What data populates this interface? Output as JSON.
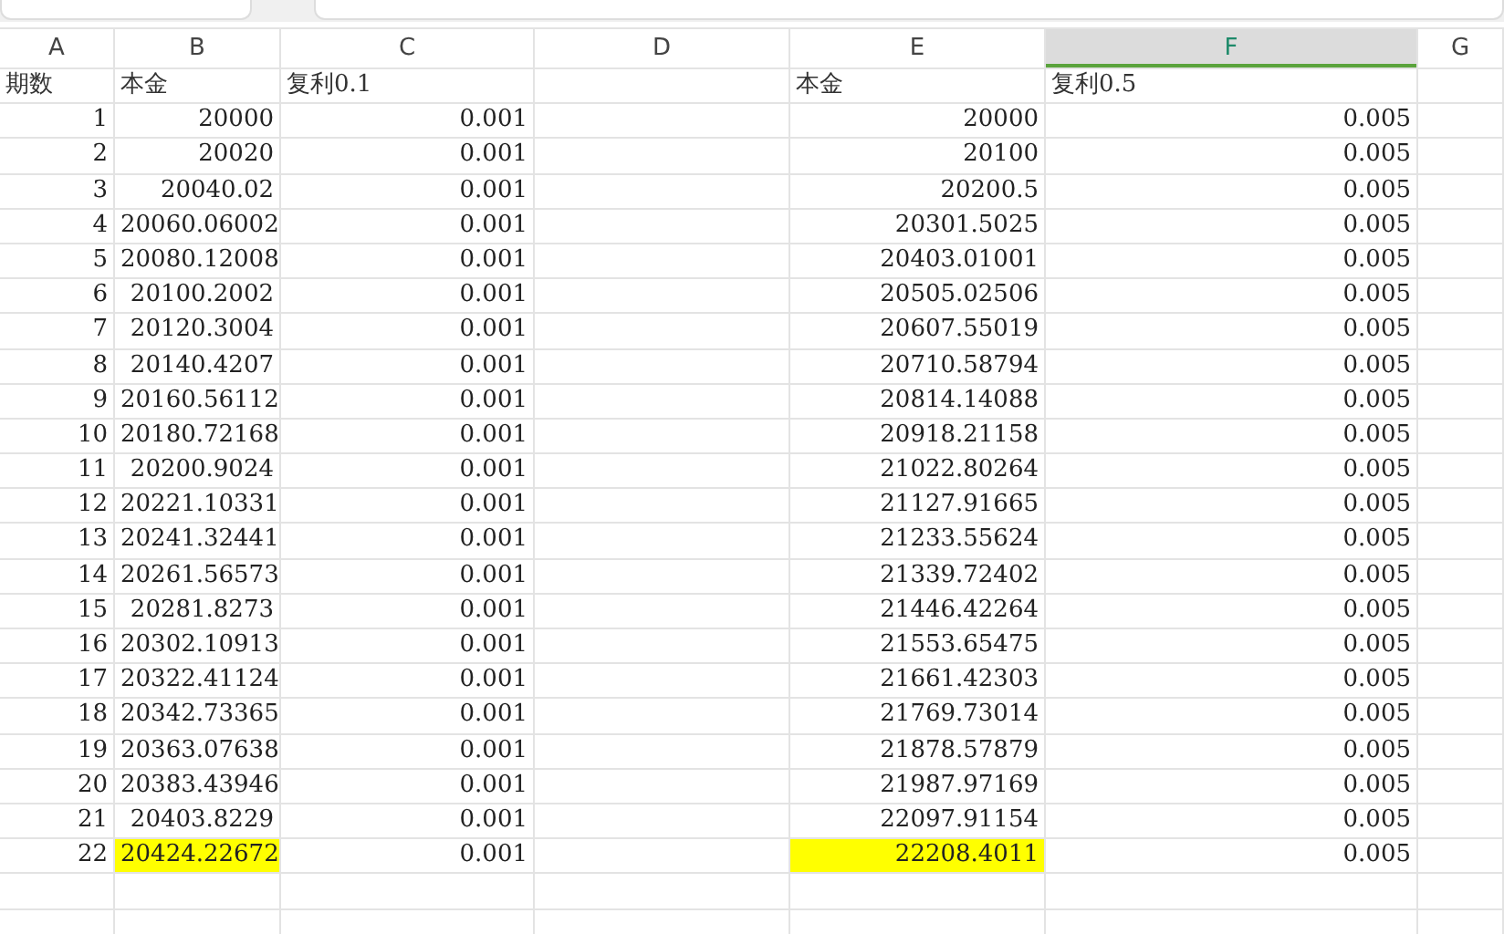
{
  "columns": [
    {
      "label": "A",
      "selected": false
    },
    {
      "label": "B",
      "selected": false
    },
    {
      "label": "C",
      "selected": false
    },
    {
      "label": "D",
      "selected": false
    },
    {
      "label": "E",
      "selected": false
    },
    {
      "label": "F",
      "selected": true
    },
    {
      "label": "G",
      "selected": false
    }
  ],
  "header_row": {
    "a": "期数",
    "b": "本金",
    "c": "复利0.1",
    "e": "本金",
    "f": "复利0.5"
  },
  "rows": [
    {
      "a": "1",
      "b": "20000",
      "c": "0.001",
      "e": "20000",
      "f": "0.005",
      "highlighted": false
    },
    {
      "a": "2",
      "b": "20020",
      "c": "0.001",
      "e": "20100",
      "f": "0.005",
      "highlighted": false
    },
    {
      "a": "3",
      "b": "20040.02",
      "c": "0.001",
      "e": "20200.5",
      "f": "0.005",
      "highlighted": false
    },
    {
      "a": "4",
      "b": "20060.06002",
      "c": "0.001",
      "e": "20301.5025",
      "f": "0.005",
      "highlighted": false
    },
    {
      "a": "5",
      "b": "20080.12008",
      "c": "0.001",
      "e": "20403.01001",
      "f": "0.005",
      "highlighted": false
    },
    {
      "a": "6",
      "b": "20100.2002",
      "c": "0.001",
      "e": "20505.02506",
      "f": "0.005",
      "highlighted": false
    },
    {
      "a": "7",
      "b": "20120.3004",
      "c": "0.001",
      "e": "20607.55019",
      "f": "0.005",
      "highlighted": false
    },
    {
      "a": "8",
      "b": "20140.4207",
      "c": "0.001",
      "e": "20710.58794",
      "f": "0.005",
      "highlighted": false
    },
    {
      "a": "9",
      "b": "20160.56112",
      "c": "0.001",
      "e": "20814.14088",
      "f": "0.005",
      "highlighted": false
    },
    {
      "a": "10",
      "b": "20180.72168",
      "c": "0.001",
      "e": "20918.21158",
      "f": "0.005",
      "highlighted": false
    },
    {
      "a": "11",
      "b": "20200.9024",
      "c": "0.001",
      "e": "21022.80264",
      "f": "0.005",
      "highlighted": false
    },
    {
      "a": "12",
      "b": "20221.10331",
      "c": "0.001",
      "e": "21127.91665",
      "f": "0.005",
      "highlighted": false
    },
    {
      "a": "13",
      "b": "20241.32441",
      "c": "0.001",
      "e": "21233.55624",
      "f": "0.005",
      "highlighted": false
    },
    {
      "a": "14",
      "b": "20261.56573",
      "c": "0.001",
      "e": "21339.72402",
      "f": "0.005",
      "highlighted": false
    },
    {
      "a": "15",
      "b": "20281.8273",
      "c": "0.001",
      "e": "21446.42264",
      "f": "0.005",
      "highlighted": false
    },
    {
      "a": "16",
      "b": "20302.10913",
      "c": "0.001",
      "e": "21553.65475",
      "f": "0.005",
      "highlighted": false
    },
    {
      "a": "17",
      "b": "20322.41124",
      "c": "0.001",
      "e": "21661.42303",
      "f": "0.005",
      "highlighted": false
    },
    {
      "a": "18",
      "b": "20342.73365",
      "c": "0.001",
      "e": "21769.73014",
      "f": "0.005",
      "highlighted": false
    },
    {
      "a": "19",
      "b": "20363.07638",
      "c": "0.001",
      "e": "21878.57879",
      "f": "0.005",
      "highlighted": false
    },
    {
      "a": "20",
      "b": "20383.43946",
      "c": "0.001",
      "e": "21987.97169",
      "f": "0.005",
      "highlighted": false
    },
    {
      "a": "21",
      "b": "20403.8229",
      "c": "0.001",
      "e": "22097.91154",
      "f": "0.005",
      "highlighted": false
    },
    {
      "a": "22",
      "b": "20424.22672",
      "c": "0.001",
      "e": "22208.4011",
      "f": "0.005",
      "highlighted": true
    }
  ]
}
